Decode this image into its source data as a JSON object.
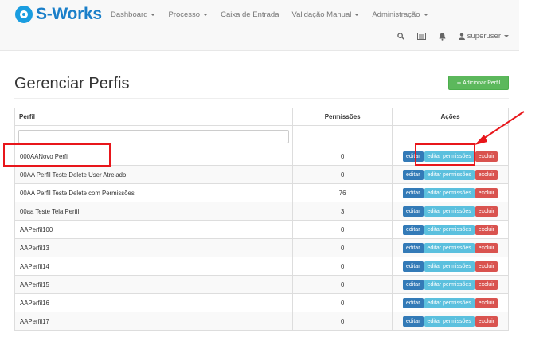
{
  "brand": "S-Works",
  "nav": {
    "items": [
      {
        "label": "Dashboard",
        "dropdown": true
      },
      {
        "label": "Processo",
        "dropdown": true
      },
      {
        "label": "Caixa de Entrada",
        "dropdown": false
      },
      {
        "label": "Validação Manual",
        "dropdown": true
      },
      {
        "label": "Administração",
        "dropdown": true
      }
    ],
    "user": "superuser"
  },
  "page": {
    "title": "Gerenciar Perfis",
    "add_button": "Adicionar Perfil"
  },
  "table": {
    "headers": {
      "profile": "Perfil",
      "permissions": "Permissões",
      "actions": "Ações"
    },
    "filter_placeholder": "",
    "actions": {
      "edit": "editar",
      "edit_permissions": "editar permissões",
      "delete": "excluir"
    },
    "rows": [
      {
        "name": "000AANovo Perfil",
        "permissions": "0"
      },
      {
        "name": "00AA Perfil Teste Delete User Atrelado",
        "permissions": "0"
      },
      {
        "name": "00AA Perfil Teste Delete com Permissões",
        "permissions": "76"
      },
      {
        "name": "00aa Teste Tela Perfil",
        "permissions": "3"
      },
      {
        "name": "AAPerfil100",
        "permissions": "0"
      },
      {
        "name": "AAPerfil13",
        "permissions": "0"
      },
      {
        "name": "AAPerfil14",
        "permissions": "0"
      },
      {
        "name": "AAPerfil15",
        "permissions": "0"
      },
      {
        "name": "AAPerfil16",
        "permissions": "0"
      },
      {
        "name": "AAPerfil17",
        "permissions": "0"
      }
    ]
  },
  "colors": {
    "brand": "#1a7fc9",
    "add_button": "#5cb85c",
    "edit_button": "#337ab7",
    "edit_permissions_button": "#5bc0de",
    "delete_button": "#d9534f",
    "annotation": "#e8161b"
  }
}
